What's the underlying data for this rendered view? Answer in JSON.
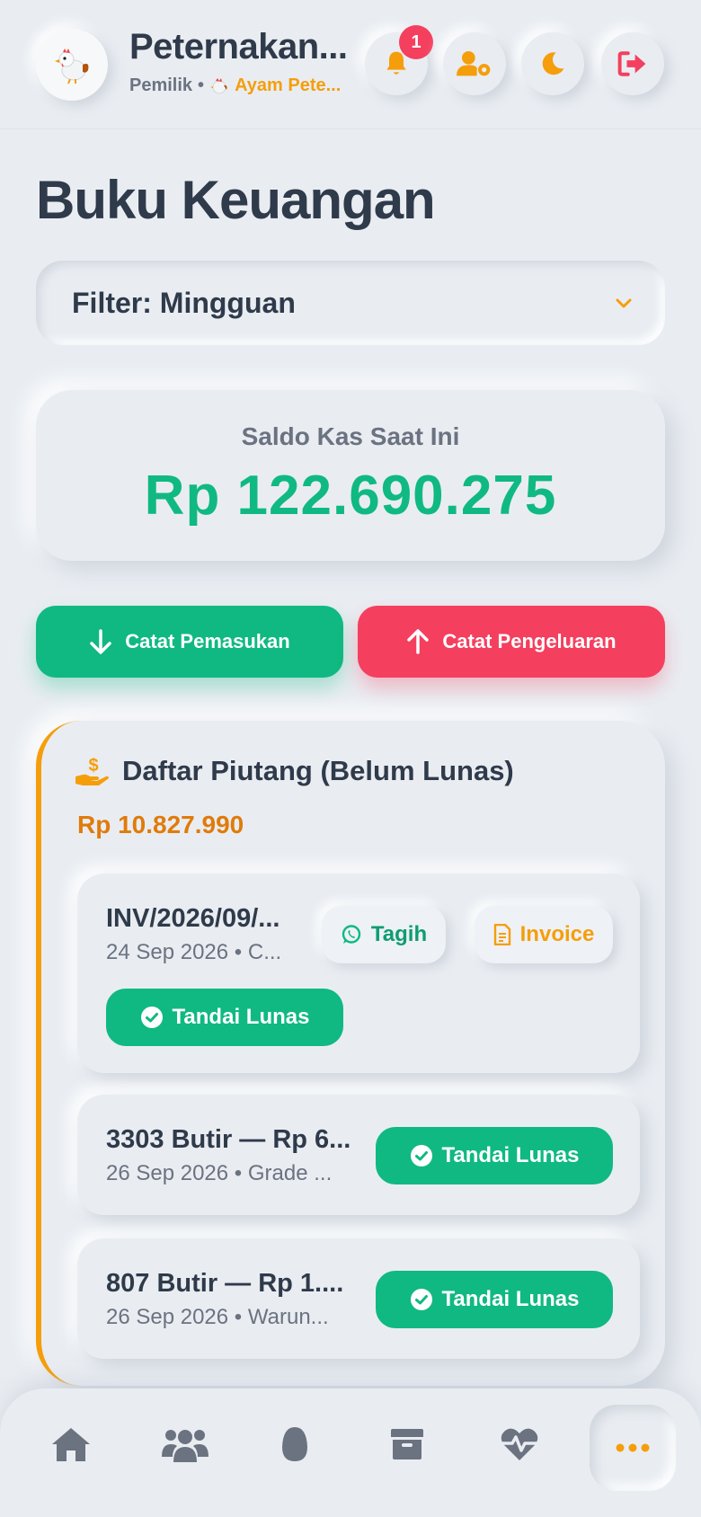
{
  "header": {
    "farm_title": "Peternakan...",
    "role": "Pemilik",
    "separator": "•",
    "farm_name": "Ayam Pete...",
    "notification_count": "1"
  },
  "page": {
    "title": "Buku Keuangan"
  },
  "filter": {
    "label": "Filter: Mingguan"
  },
  "balance": {
    "label": "Saldo Kas Saat Ini",
    "value": "Rp 122.690.275"
  },
  "actions": {
    "income": "Catat Pemasukan",
    "expense": "Catat Pengeluaran"
  },
  "receivables": {
    "title": "Daftar Piutang (Belum Lunas)",
    "total": "Rp 10.827.990",
    "items": [
      {
        "title": "INV/2026/09/...",
        "subtitle": "24 Sep 2026 • C...",
        "bill": "Tagih",
        "invoice": "Invoice",
        "mark_paid": "Tandai Lunas"
      },
      {
        "title": "3303 Butir — Rp 6...",
        "subtitle": "26 Sep 2026 • Grade ...",
        "mark_paid": "Tandai Lunas"
      },
      {
        "title": "807 Butir — Rp 1....",
        "subtitle": "26 Sep 2026 • Warun...",
        "mark_paid": "Tandai Lunas"
      }
    ]
  },
  "colors": {
    "accent_green": "#10b981",
    "accent_red": "#f43f5e",
    "accent_orange": "#f59e0b",
    "background": "#e9edf2"
  },
  "icons": {
    "header": [
      "chicken-icon",
      "bell-icon",
      "user-gear-icon",
      "moon-icon",
      "logout-icon"
    ],
    "nav": [
      "home-icon",
      "users-icon",
      "egg-icon",
      "box-icon",
      "heart-pulse-icon",
      "more-icon"
    ]
  }
}
